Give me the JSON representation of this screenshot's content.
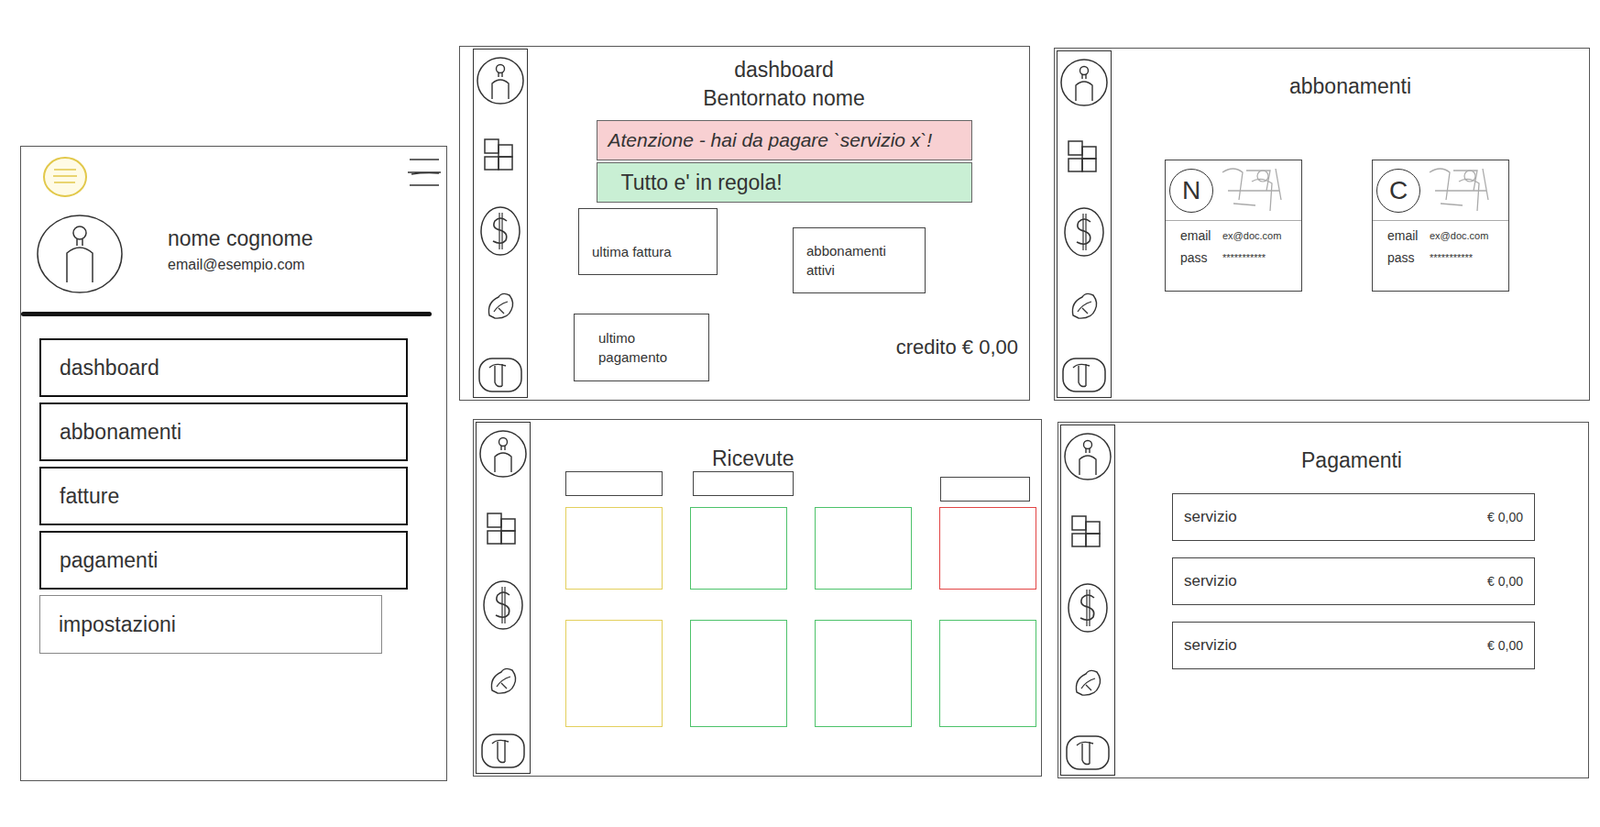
{
  "mobile": {
    "name": "nome cognome",
    "email": "email@esempio.com",
    "menu": [
      {
        "label": "dashboard",
        "outlined": true
      },
      {
        "label": "abbonamenti",
        "outlined": true
      },
      {
        "label": "fatture",
        "outlined": true
      },
      {
        "label": "pagamenti",
        "outlined": true
      },
      {
        "label": "impostazioni",
        "outlined": false
      }
    ]
  },
  "dashboard": {
    "title": "dashboard",
    "greeting": "Bentornato nome",
    "alerts": [
      {
        "text": "Atenzione - hai da pagare `servizio x`!",
        "kind": "warning",
        "color": "#f8d0d2"
      },
      {
        "text": "Tutto e' in regola!",
        "kind": "ok",
        "color": "#c9efd4"
      }
    ],
    "cards": {
      "last_invoice": "ultima fattura",
      "active_subscriptions": "abbonamenti attivi",
      "last_payment": "ultimo pagamento"
    },
    "credit": "credito € 0,00"
  },
  "abbonamenti": {
    "title": "abbonamenti",
    "cards": [
      {
        "initial": "N",
        "email_label": "email",
        "email": "ex@doc.com",
        "pass_label": "pass",
        "pass": "***********"
      },
      {
        "initial": "C",
        "email_label": "email",
        "email": "ex@doc.com",
        "pass_label": "pass",
        "pass": "***********"
      }
    ]
  },
  "ricevute": {
    "title": "Ricevute",
    "receipts": [
      {
        "color": "#e3cf5c"
      },
      {
        "color": "#4cc26a"
      },
      {
        "color": "#4cc26a"
      },
      {
        "color": "#e24444"
      },
      {
        "color": "#e3cf5c"
      },
      {
        "color": "#4cc26a"
      },
      {
        "color": "#4cc26a"
      },
      {
        "color": "#4cc26a"
      }
    ]
  },
  "pagamenti": {
    "title": "Pagamenti",
    "rows": [
      {
        "service": "servizio",
        "amount": "€ 0,00"
      },
      {
        "service": "servizio",
        "amount": "€ 0,00"
      },
      {
        "service": "servizio",
        "amount": "€ 0,00"
      }
    ]
  }
}
